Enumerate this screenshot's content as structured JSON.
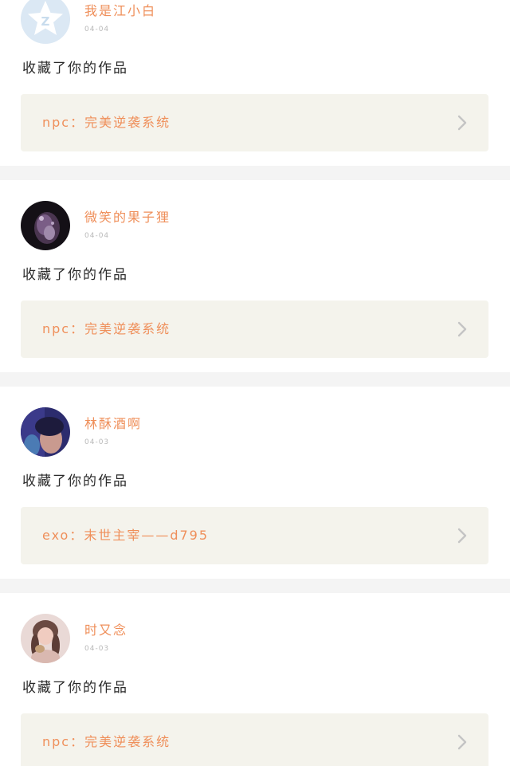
{
  "feed": {
    "items": [
      {
        "avatar": "qzone-star-avatar",
        "username": "我是江小白",
        "date": "04-04",
        "action": "收藏了你的作品",
        "work_title": "npc：完美逆袭系统",
        "chevron_icon": "chevron-right-icon"
      },
      {
        "avatar": "dark-crystal-avatar",
        "username": "微笑的果子狸",
        "date": "04-04",
        "action": "收藏了你的作品",
        "work_title": "npc：完美逆袭系统",
        "chevron_icon": "chevron-right-icon"
      },
      {
        "avatar": "purple-photo-avatar",
        "username": "林酥酒啊",
        "date": "04-03",
        "action": "收藏了你的作品",
        "work_title": "exo：末世主宰——d795",
        "chevron_icon": "chevron-right-icon"
      },
      {
        "avatar": "girl-photo-avatar",
        "username": "时又念",
        "date": "04-03",
        "action": "收藏了你的作品",
        "work_title": "npc：完美逆袭系统",
        "chevron_icon": "chevron-right-icon"
      }
    ]
  },
  "colors": {
    "accent": "#ef8f5a",
    "date": "#b9b9b9",
    "card_box": "#f4f3ec",
    "separator": "#f4f4f4",
    "text": "#2a2a2a",
    "chevron": "#c4c4c4"
  }
}
